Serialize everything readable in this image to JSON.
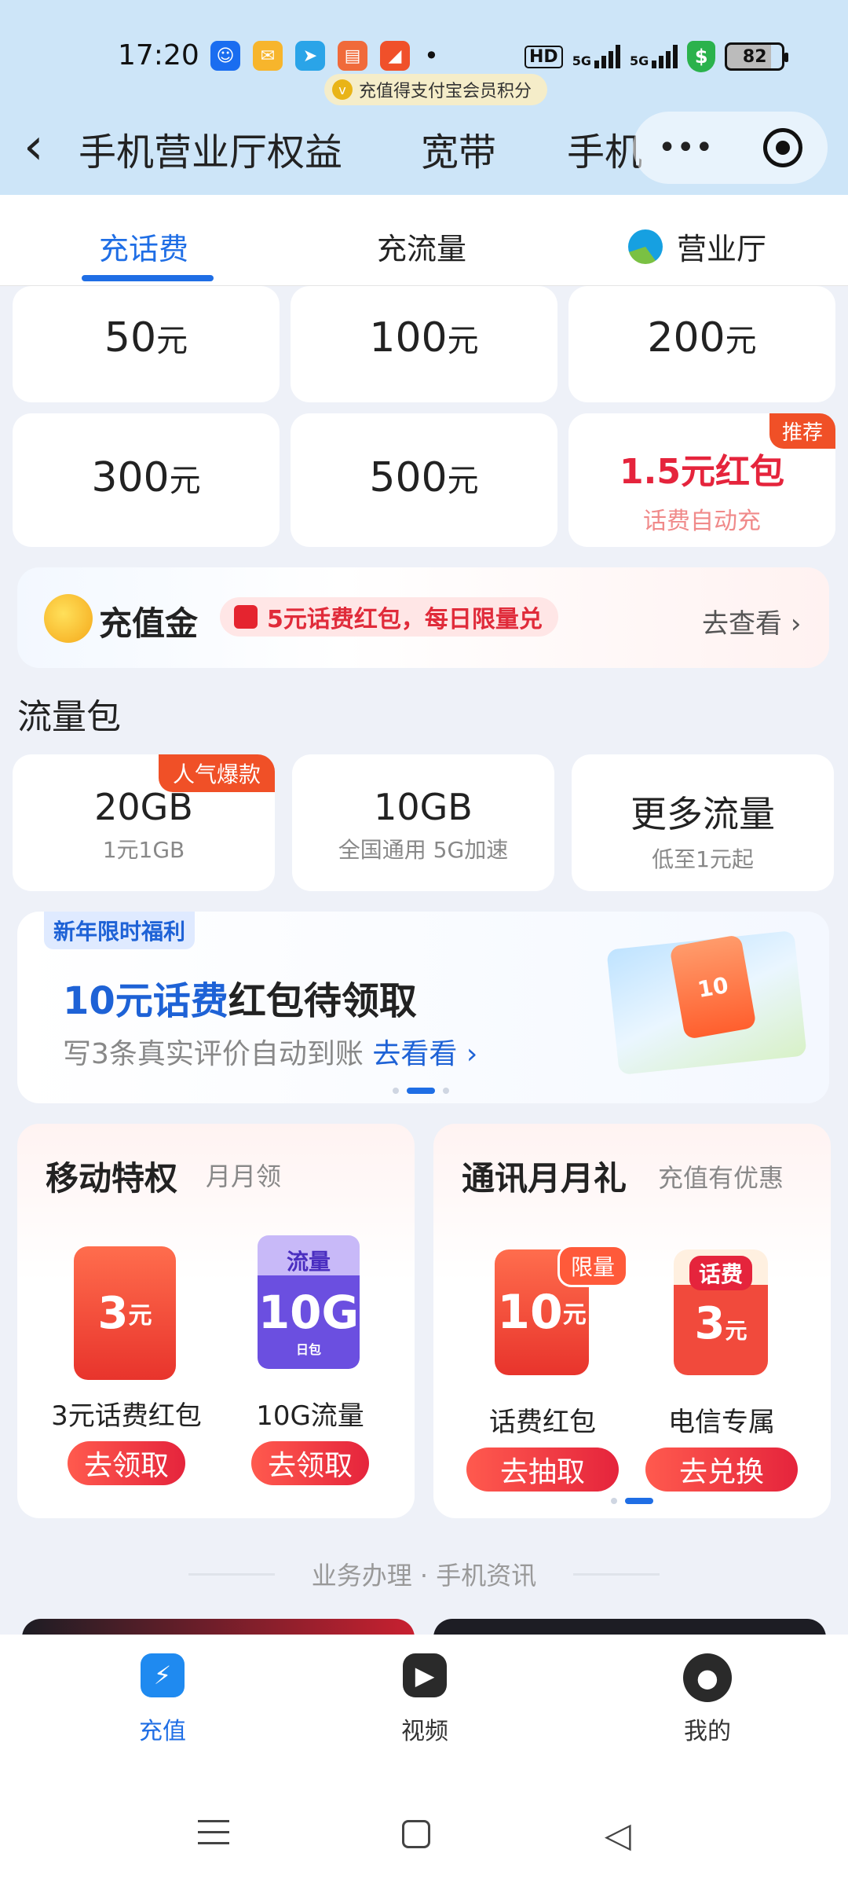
{
  "status_bar": {
    "time": "17:20",
    "alipay_pill": "充值得支付宝会员积分",
    "hd": "HD",
    "net1": "5G",
    "net2": "5G",
    "battery": "82"
  },
  "header": {
    "top_tabs": [
      "手机营业厅",
      "权益",
      "宽带",
      "手机"
    ],
    "more_icon": "more-dots-icon",
    "target_icon": "target-icon"
  },
  "subtabs": {
    "items": [
      "充话费",
      "充流量",
      "营业厅"
    ],
    "active_index": 0,
    "accent": "#1f6ee5"
  },
  "amounts": [
    {
      "value": "50",
      "unit": "元"
    },
    {
      "value": "100",
      "unit": "元"
    },
    {
      "value": "200",
      "unit": "元"
    },
    {
      "value": "300",
      "unit": "元"
    },
    {
      "value": "500",
      "unit": "元"
    }
  ],
  "promo_amount": {
    "title": "1.5元红包",
    "subtitle": "话费自动充",
    "tag": "推荐"
  },
  "gold": {
    "title": "充值金",
    "pill": "5元话费红包，每日限量兑",
    "link": "去查看"
  },
  "flow_section": {
    "title": "流量包",
    "items": [
      {
        "big": "20GB",
        "sub": "1元1GB",
        "tag": "人气爆款"
      },
      {
        "big": "10GB",
        "sub": "全国通用 5G加速"
      },
      {
        "big": "更多流量",
        "sub": "低至1元起"
      }
    ]
  },
  "promo_banner": {
    "badge": "新年限时福利",
    "title_blue": "10元话费",
    "title_rest": "红包待领取",
    "subtitle": "写3条真实评价自动到账",
    "link": "去看看",
    "art_text": "10"
  },
  "privilege": {
    "title": "移动特权",
    "sub": "月月领",
    "items": [
      {
        "art_value": "3",
        "art_unit": "元",
        "label": "3元话费红包",
        "button": "去领取"
      },
      {
        "art_top": "流量",
        "art_value": "10G",
        "art_sub": "日包",
        "label": "10G流量",
        "button": "去领取"
      }
    ]
  },
  "monthly_gift": {
    "title": "通讯月月礼",
    "sub": "充值有优惠",
    "items": [
      {
        "art_value": "10",
        "art_unit": "元",
        "tag": "限量",
        "label": "话费红包",
        "button": "去抽取"
      },
      {
        "art_top": "话费",
        "art_value": "3",
        "art_unit": "元",
        "label": "电信专属",
        "button": "去兑换"
      }
    ]
  },
  "footer_caption": "业务办理 · 手机资讯",
  "bottom_nav": [
    {
      "label": "充值",
      "icon": "lightning-icon",
      "active": true
    },
    {
      "label": "视频",
      "icon": "tv-icon",
      "active": false
    },
    {
      "label": "我的",
      "icon": "person-icon",
      "active": false
    }
  ]
}
